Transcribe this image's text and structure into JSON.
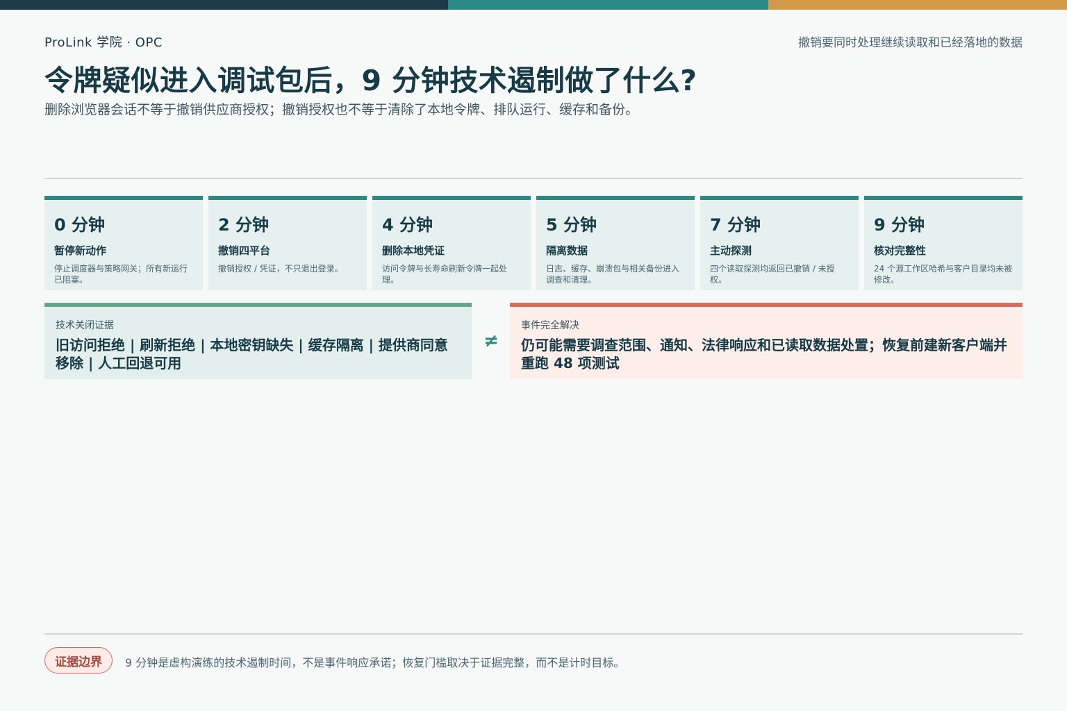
{
  "brand": "ProLink 学院 · OPC",
  "tagline": "撤销要同时处理继续读取和已经落地的数据",
  "title": "令牌疑似进入调试包后，9 分钟技术遏制做了什么?",
  "subtitle": "删除浏览器会话不等于撤销供应商授权；撤销授权也不等于清除了本地令牌、排队运行、缓存和备份。",
  "colors": {
    "navy": "#1d3a48",
    "teal": "#2a8a86",
    "amber": "#d39a4a",
    "green": "#67a58a",
    "coral": "#d2705f"
  },
  "timeline": [
    {
      "time": "0 分钟",
      "label": "暂停新动作",
      "desc": "停止调度器与策略网关；所有新运行已阻塞。"
    },
    {
      "time": "2 分钟",
      "label": "撤销四平台",
      "desc": "撤销授权 / 凭证，不只退出登录。"
    },
    {
      "time": "4 分钟",
      "label": "删除本地凭证",
      "desc": "访问令牌与长寿命刷新令牌一起处理。"
    },
    {
      "time": "5 分钟",
      "label": "隔离数据",
      "desc": "日志、缓存、崩溃包与相关备份进入调查和清理。"
    },
    {
      "time": "7 分钟",
      "label": "主动探测",
      "desc": "四个读取探测均返回已撤销 / 未授权。"
    },
    {
      "time": "9 分钟",
      "label": "核对完整性",
      "desc": "24 个源工作区哈希与客户目录均未被修改。"
    }
  ],
  "left_panel": {
    "kicker": "技术关闭证据",
    "body": "旧访问拒绝 | 刷新拒绝 | 本地密钥缺失 | 缓存隔离 | 提供商同意移除 | 人工回退可用"
  },
  "operator": "≠",
  "right_panel": {
    "kicker": "事件完全解决",
    "body": "仍可能需要调查范围、通知、法律响应和已读取数据处置；恢复前建新客户端并重跑 48 项测试"
  },
  "footer": {
    "badge": "证据边界",
    "note": "9 分钟是虚构演练的技术遏制时间，不是事件响应承诺；恢复门槛取决于证据完整，而不是计时目标。"
  }
}
